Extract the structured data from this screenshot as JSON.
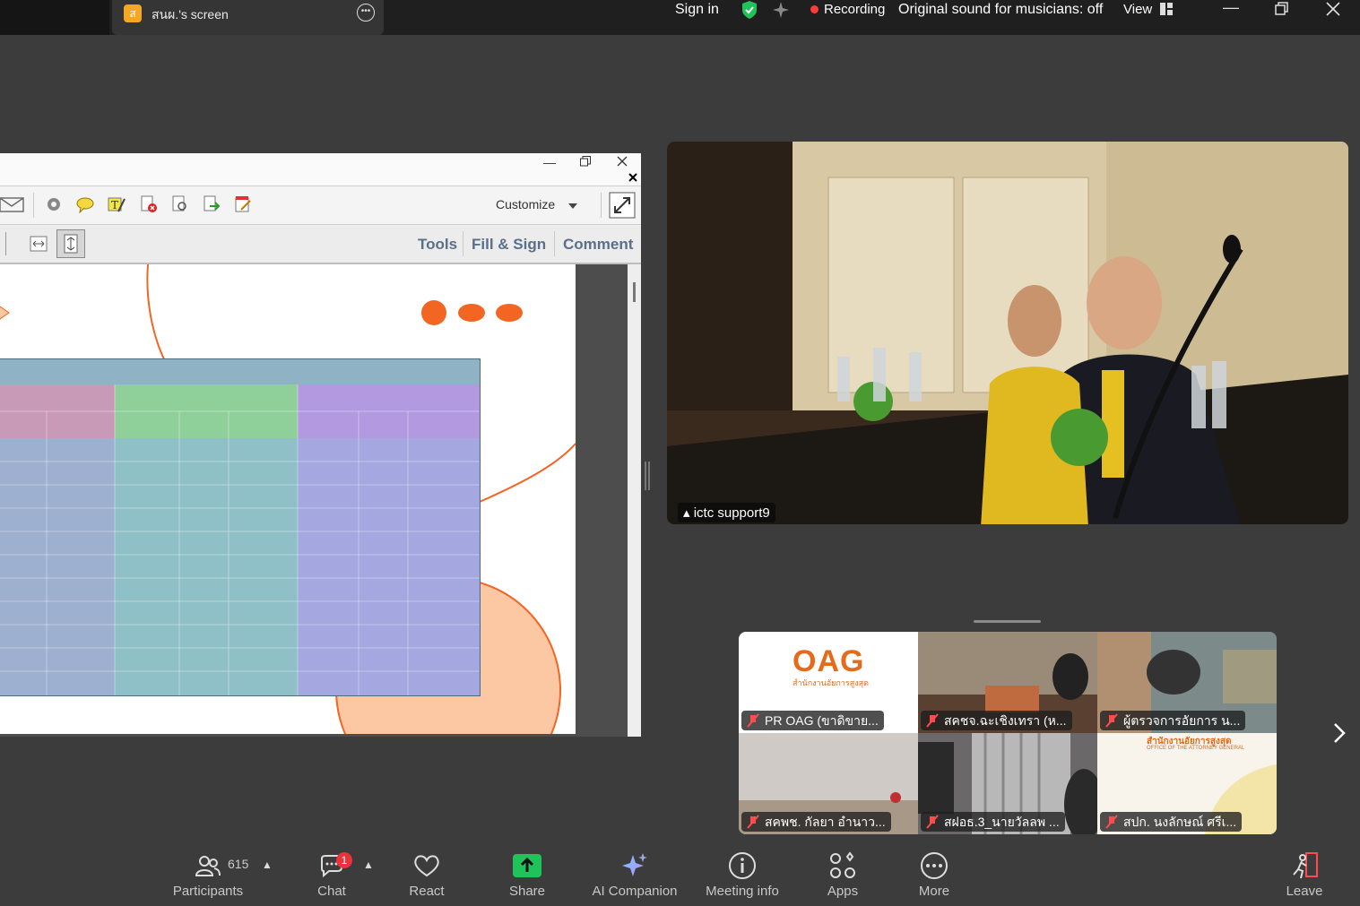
{
  "topbar": {
    "share_badge": "ส",
    "share_title": "สนผ.'s screen",
    "sign_in": "Sign in",
    "recording": "Recording",
    "original_sound": "Original sound for musicians: off",
    "view": "View"
  },
  "acrobat": {
    "customize": "Customize",
    "tabs": {
      "tools": "Tools",
      "fill_sign": "Fill & Sign",
      "comment": "Comment"
    }
  },
  "video": {
    "speaker_name": "ictc support9"
  },
  "gallery": [
    {
      "name": "PR OAG (ขาดิขาย...",
      "logo": "OAG",
      "logo_sub": "สำนักงานอัยการสูงสุด"
    },
    {
      "name": "สคชจ.ฉะเชิงเทรา (ห..."
    },
    {
      "name": "ผู้ตรวจการอัยการ น..."
    },
    {
      "name": "สคพช. กัลยา อำนาว..."
    },
    {
      "name": "สฝอธ.3_นายวัลลพ ..."
    },
    {
      "name": "สปก. นงลักษณ์ ศรีเ...",
      "logo_sub": "สำนักงานอัยการสูงสุด",
      "logo_sub2": "OFFICE OF THE ATTORNEY GENERAL"
    }
  ],
  "controls": {
    "participants": "Participants",
    "participants_count": "615",
    "chat": "Chat",
    "chat_badge": "1",
    "react": "React",
    "share": "Share",
    "ai_companion": "AI Companion",
    "meeting_info": "Meeting info",
    "apps": "Apps",
    "more": "More",
    "leave": "Leave"
  },
  "colors": {
    "share_green": "#20c35a",
    "rec_red": "#ff3b3b",
    "leave_red": "#ff4d4d",
    "orange": "#f26522"
  }
}
